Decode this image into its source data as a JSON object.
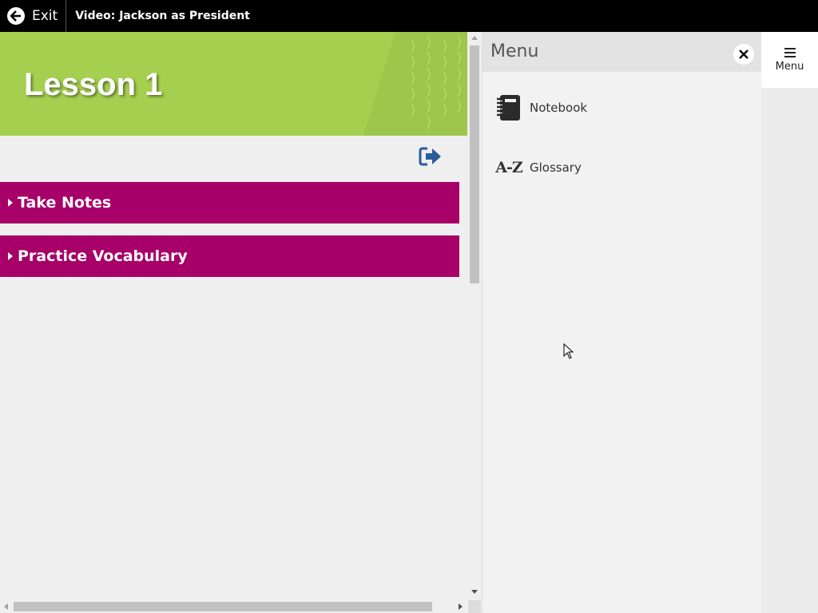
{
  "topbar": {
    "exit_label": "Exit",
    "title": "Video: Jackson as President"
  },
  "lesson": {
    "banner_title": "Lesson 1",
    "accordions": [
      {
        "label": "Take Notes"
      },
      {
        "label": "Practice Vocabulary"
      }
    ]
  },
  "menu": {
    "title": "Menu",
    "items": [
      {
        "label": "Notebook",
        "icon": "notebook-icon"
      },
      {
        "label": "Glossary",
        "icon": "a-z-icon",
        "icon_text": "A-Z"
      }
    ]
  },
  "menu_button": {
    "label": "Menu",
    "icon": "hamburger-icon"
  },
  "colors": {
    "banner_green": "#a5cf4f",
    "accordion_magenta": "#a70068",
    "topbar": "#000000",
    "export_icon_blue": "#2a5b9c"
  }
}
